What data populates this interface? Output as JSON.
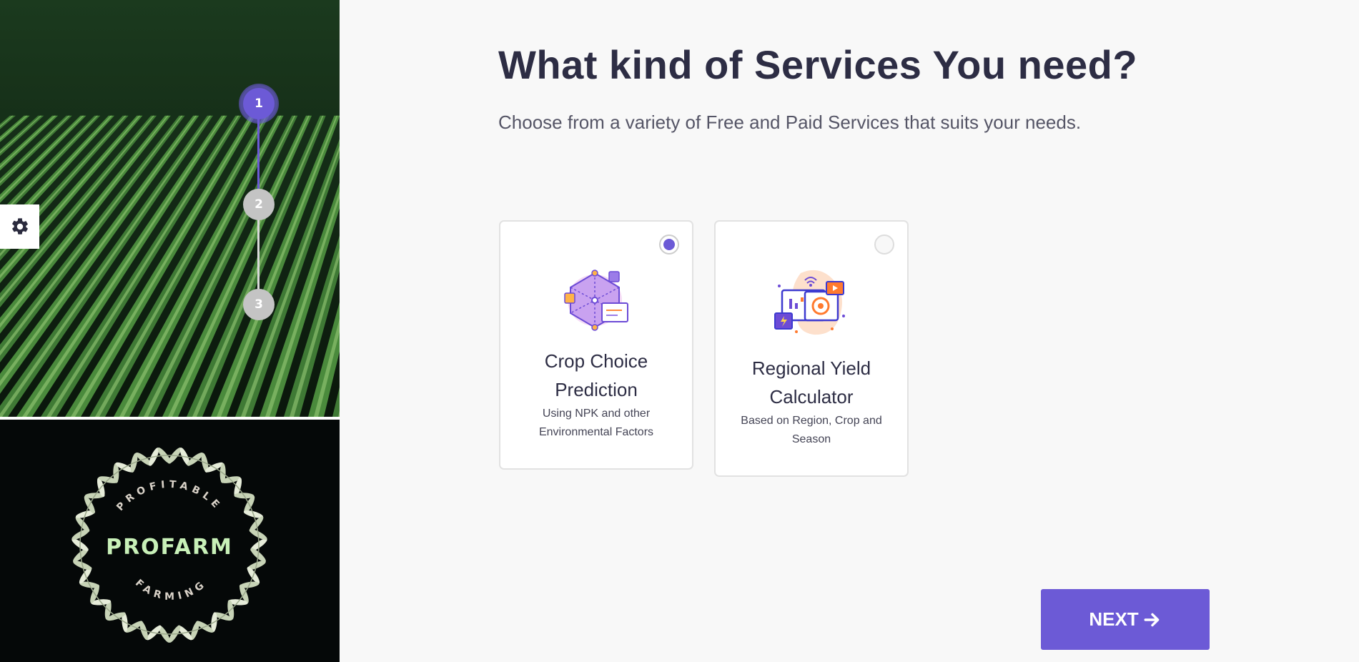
{
  "wizard": {
    "steps": [
      "1",
      "2",
      "3"
    ],
    "active_step": 1
  },
  "logo": {
    "top_text": "PROFITABLE",
    "brand": "PROFARM",
    "bottom_text": "FARMING"
  },
  "settings": {
    "icon": "gear-icon"
  },
  "heading": {
    "title": "What kind of Services You need?",
    "subtitle": "Choose from a variety of Free and Paid Services that suits your needs."
  },
  "services": [
    {
      "title_line1": "Crop Choice",
      "title_line2": "Prediction",
      "desc_line1": "Using NPK and other",
      "desc_line2": "Environmental Factors",
      "selected": true,
      "icon": "network-analysis-icon"
    },
    {
      "title_line1": "Regional Yield",
      "title_line2": "Calculator",
      "desc_line1": "Based on Region, Crop and",
      "desc_line2": "Season",
      "selected": false,
      "icon": "dashboard-analytics-icon"
    }
  ],
  "next_button": {
    "label": "NEXT",
    "icon": "arrow-right-icon"
  },
  "colors": {
    "accent": "#6c5ad6",
    "title": "#2d2d44",
    "inactive_step": "#c4c4c4",
    "background": "#f8f8f8"
  }
}
